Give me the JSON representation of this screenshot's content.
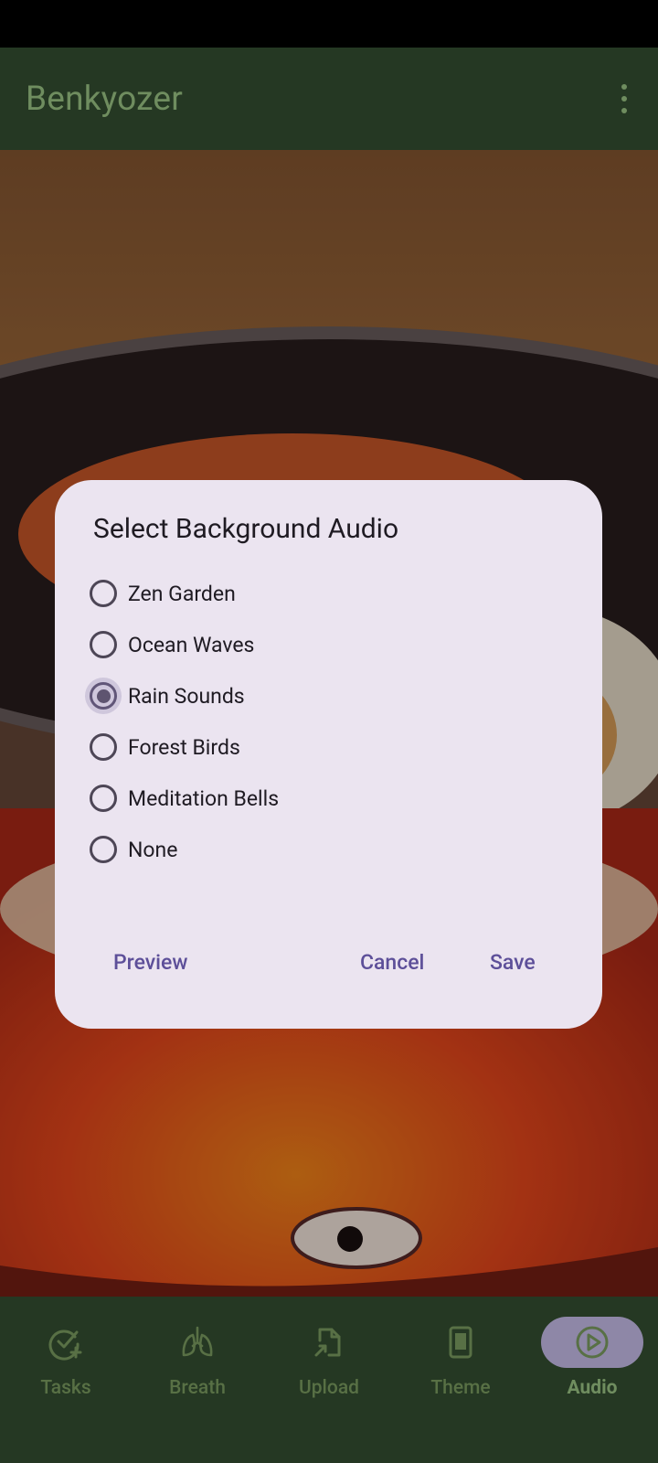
{
  "app": {
    "title": "Benkyozer"
  },
  "dialog": {
    "title": "Select Background Audio",
    "options": [
      {
        "label": "Zen Garden",
        "selected": false
      },
      {
        "label": "Ocean Waves",
        "selected": false
      },
      {
        "label": "Rain Sounds",
        "selected": true
      },
      {
        "label": "Forest Birds",
        "selected": false
      },
      {
        "label": "Meditation Bells",
        "selected": false
      },
      {
        "label": "None",
        "selected": false
      }
    ],
    "preview_label": "Preview",
    "cancel_label": "Cancel",
    "save_label": "Save"
  },
  "bottom_nav": {
    "items": [
      {
        "label": "Tasks",
        "icon": "task-add-icon",
        "active": false
      },
      {
        "label": "Breath",
        "icon": "lungs-icon",
        "active": false
      },
      {
        "label": "Upload",
        "icon": "file-upload-icon",
        "active": false
      },
      {
        "label": "Theme",
        "icon": "theme-icon",
        "active": false
      },
      {
        "label": "Audio",
        "icon": "play-circle-icon",
        "active": true
      }
    ]
  },
  "colors": {
    "appbar": "#253823",
    "title": "#6f8d5f",
    "dialog_bg": "#ebe4f0",
    "accent": "#5d4f99",
    "active_nav_pill": "#8e87a7"
  }
}
